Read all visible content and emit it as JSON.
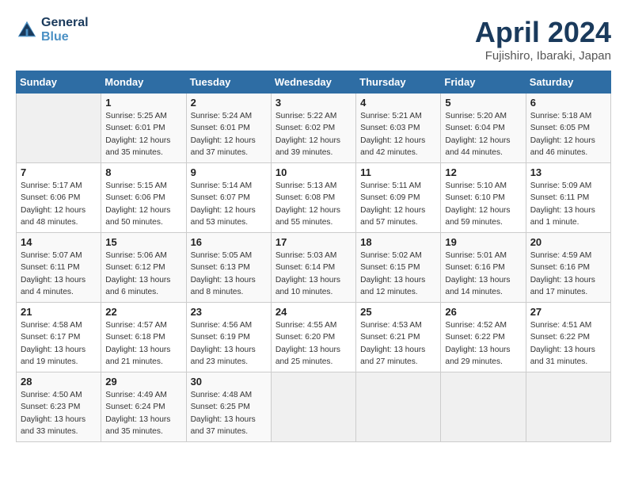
{
  "header": {
    "logo_line1": "General",
    "logo_line2": "Blue",
    "month": "April 2024",
    "location": "Fujishiro, Ibaraki, Japan"
  },
  "weekdays": [
    "Sunday",
    "Monday",
    "Tuesday",
    "Wednesday",
    "Thursday",
    "Friday",
    "Saturday"
  ],
  "weeks": [
    [
      {
        "day": "",
        "info": ""
      },
      {
        "day": "1",
        "info": "Sunrise: 5:25 AM\nSunset: 6:01 PM\nDaylight: 12 hours\nand 35 minutes."
      },
      {
        "day": "2",
        "info": "Sunrise: 5:24 AM\nSunset: 6:01 PM\nDaylight: 12 hours\nand 37 minutes."
      },
      {
        "day": "3",
        "info": "Sunrise: 5:22 AM\nSunset: 6:02 PM\nDaylight: 12 hours\nand 39 minutes."
      },
      {
        "day": "4",
        "info": "Sunrise: 5:21 AM\nSunset: 6:03 PM\nDaylight: 12 hours\nand 42 minutes."
      },
      {
        "day": "5",
        "info": "Sunrise: 5:20 AM\nSunset: 6:04 PM\nDaylight: 12 hours\nand 44 minutes."
      },
      {
        "day": "6",
        "info": "Sunrise: 5:18 AM\nSunset: 6:05 PM\nDaylight: 12 hours\nand 46 minutes."
      }
    ],
    [
      {
        "day": "7",
        "info": "Sunrise: 5:17 AM\nSunset: 6:06 PM\nDaylight: 12 hours\nand 48 minutes."
      },
      {
        "day": "8",
        "info": "Sunrise: 5:15 AM\nSunset: 6:06 PM\nDaylight: 12 hours\nand 50 minutes."
      },
      {
        "day": "9",
        "info": "Sunrise: 5:14 AM\nSunset: 6:07 PM\nDaylight: 12 hours\nand 53 minutes."
      },
      {
        "day": "10",
        "info": "Sunrise: 5:13 AM\nSunset: 6:08 PM\nDaylight: 12 hours\nand 55 minutes."
      },
      {
        "day": "11",
        "info": "Sunrise: 5:11 AM\nSunset: 6:09 PM\nDaylight: 12 hours\nand 57 minutes."
      },
      {
        "day": "12",
        "info": "Sunrise: 5:10 AM\nSunset: 6:10 PM\nDaylight: 12 hours\nand 59 minutes."
      },
      {
        "day": "13",
        "info": "Sunrise: 5:09 AM\nSunset: 6:11 PM\nDaylight: 13 hours\nand 1 minute."
      }
    ],
    [
      {
        "day": "14",
        "info": "Sunrise: 5:07 AM\nSunset: 6:11 PM\nDaylight: 13 hours\nand 4 minutes."
      },
      {
        "day": "15",
        "info": "Sunrise: 5:06 AM\nSunset: 6:12 PM\nDaylight: 13 hours\nand 6 minutes."
      },
      {
        "day": "16",
        "info": "Sunrise: 5:05 AM\nSunset: 6:13 PM\nDaylight: 13 hours\nand 8 minutes."
      },
      {
        "day": "17",
        "info": "Sunrise: 5:03 AM\nSunset: 6:14 PM\nDaylight: 13 hours\nand 10 minutes."
      },
      {
        "day": "18",
        "info": "Sunrise: 5:02 AM\nSunset: 6:15 PM\nDaylight: 13 hours\nand 12 minutes."
      },
      {
        "day": "19",
        "info": "Sunrise: 5:01 AM\nSunset: 6:16 PM\nDaylight: 13 hours\nand 14 minutes."
      },
      {
        "day": "20",
        "info": "Sunrise: 4:59 AM\nSunset: 6:16 PM\nDaylight: 13 hours\nand 17 minutes."
      }
    ],
    [
      {
        "day": "21",
        "info": "Sunrise: 4:58 AM\nSunset: 6:17 PM\nDaylight: 13 hours\nand 19 minutes."
      },
      {
        "day": "22",
        "info": "Sunrise: 4:57 AM\nSunset: 6:18 PM\nDaylight: 13 hours\nand 21 minutes."
      },
      {
        "day": "23",
        "info": "Sunrise: 4:56 AM\nSunset: 6:19 PM\nDaylight: 13 hours\nand 23 minutes."
      },
      {
        "day": "24",
        "info": "Sunrise: 4:55 AM\nSunset: 6:20 PM\nDaylight: 13 hours\nand 25 minutes."
      },
      {
        "day": "25",
        "info": "Sunrise: 4:53 AM\nSunset: 6:21 PM\nDaylight: 13 hours\nand 27 minutes."
      },
      {
        "day": "26",
        "info": "Sunrise: 4:52 AM\nSunset: 6:22 PM\nDaylight: 13 hours\nand 29 minutes."
      },
      {
        "day": "27",
        "info": "Sunrise: 4:51 AM\nSunset: 6:22 PM\nDaylight: 13 hours\nand 31 minutes."
      }
    ],
    [
      {
        "day": "28",
        "info": "Sunrise: 4:50 AM\nSunset: 6:23 PM\nDaylight: 13 hours\nand 33 minutes."
      },
      {
        "day": "29",
        "info": "Sunrise: 4:49 AM\nSunset: 6:24 PM\nDaylight: 13 hours\nand 35 minutes."
      },
      {
        "day": "30",
        "info": "Sunrise: 4:48 AM\nSunset: 6:25 PM\nDaylight: 13 hours\nand 37 minutes."
      },
      {
        "day": "",
        "info": ""
      },
      {
        "day": "",
        "info": ""
      },
      {
        "day": "",
        "info": ""
      },
      {
        "day": "",
        "info": ""
      }
    ]
  ]
}
